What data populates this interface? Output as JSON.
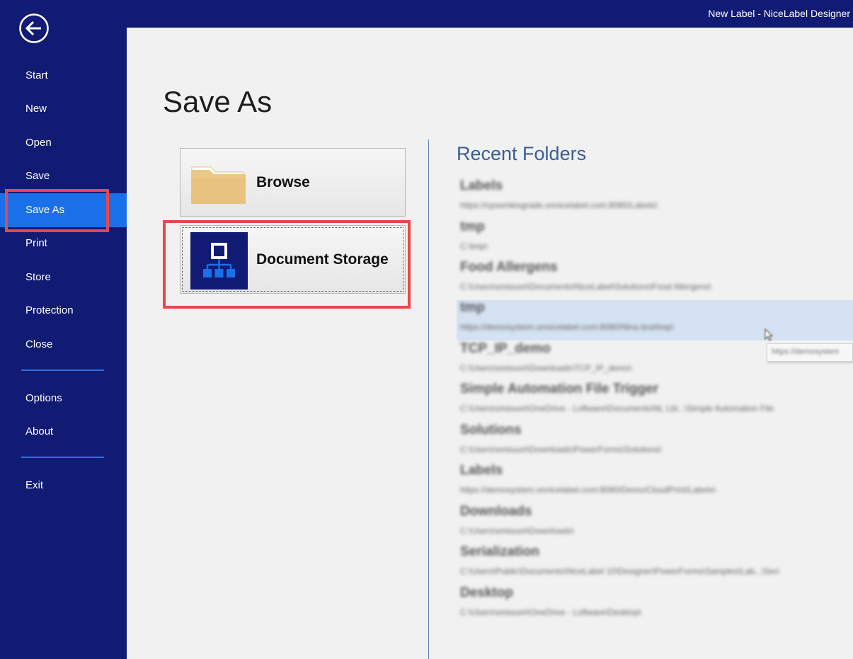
{
  "window": {
    "title": "New Label - NiceLabel Designer"
  },
  "sidebar": {
    "back_icon": "back-arrow-icon",
    "items": [
      {
        "label": "Start",
        "active": false
      },
      {
        "label": "New",
        "active": false
      },
      {
        "label": "Open",
        "active": false
      },
      {
        "label": "Save",
        "active": false
      },
      {
        "label": "Save As",
        "active": true
      },
      {
        "label": "Print",
        "active": false
      },
      {
        "label": "Store",
        "active": false
      },
      {
        "label": "Protection",
        "active": false
      },
      {
        "label": "Close",
        "active": false
      }
    ],
    "secondary": [
      {
        "label": "Options"
      },
      {
        "label": "About"
      }
    ],
    "exit": {
      "label": "Exit"
    }
  },
  "main": {
    "title": "Save As",
    "locations": [
      {
        "label": "Browse",
        "icon": "folder-icon"
      },
      {
        "label": "Document Storage",
        "icon": "document-storage-icon"
      }
    ],
    "recent_title": "Recent Folders",
    "recent_folders": [
      {
        "name": "Labels",
        "path": "https://cpsemkisgrade.onnicelabel.com:8080/Labels\\"
      },
      {
        "name": "tmp",
        "path": "C:\\tmp\\"
      },
      {
        "name": "Food Allergens",
        "path": "C:\\Users\\smisuori\\Documents\\NiceLabel\\Solutions\\Food Allergens\\"
      },
      {
        "name": "tmp",
        "path": "https://demosystem.onnicelabel.com:8080/Nina test/tmp\\",
        "selected": true
      },
      {
        "name": "TCP_IP_demo",
        "path": "C:\\Users\\smisuori\\Downloads\\TCP_IP_demo\\"
      },
      {
        "name": "Simple Automation File Trigger",
        "path": "C:\\Users\\smisuori\\OneDrive - Loftware\\Documents\\NL Lbl...\\Simple Automation File"
      },
      {
        "name": "Solutions",
        "path": "C:\\Users\\smisuori\\Downloads\\PowerForms\\Solutions\\"
      },
      {
        "name": "Labels",
        "path": "https://demosystem.onnicelabel.com:8080/Demo/CloudPrint/Labels\\"
      },
      {
        "name": "Downloads",
        "path": "C:\\Users\\smisuori\\Downloads\\"
      },
      {
        "name": "Serialization",
        "path": "C:\\Users\\Public\\Documents\\NiceLabel 10\\Designer\\PowerForms\\Samples\\Lab...\\Seri"
      },
      {
        "name": "Desktop",
        "path": "C:\\Users\\smisuori\\OneDrive - Loftware\\Desktop\\"
      }
    ],
    "tooltip": "https://demosystem"
  },
  "colors": {
    "sidebar_bg": "#111b73",
    "active_bg": "#1a70e8",
    "highlight": "#e8474b",
    "recent_title": "#3c5e94"
  }
}
